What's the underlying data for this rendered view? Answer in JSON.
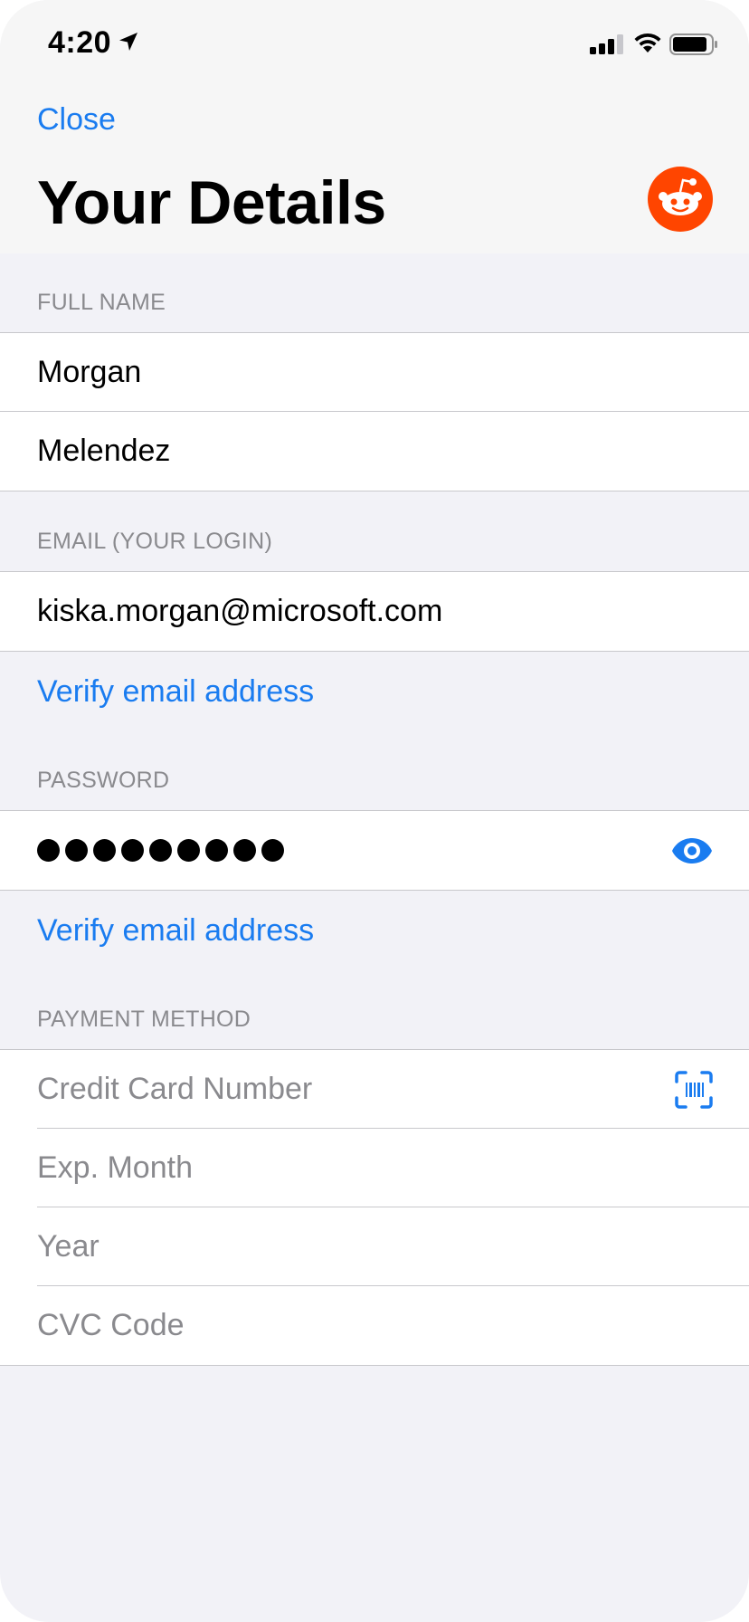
{
  "status_bar": {
    "time": "4:20",
    "icons": [
      "location-arrow-icon",
      "cellular-signal-icon",
      "wifi-icon",
      "battery-icon"
    ]
  },
  "nav": {
    "close_label": "Close",
    "title": "Your Details",
    "logo": "reddit-logo-icon"
  },
  "sections": {
    "full_name": {
      "header": "FULL NAME",
      "first_name": "Morgan",
      "last_name": "Melendez"
    },
    "email": {
      "header": "EMAIL (YOUR LOGIN)",
      "value": "kiska.morgan@microsoft.com",
      "verify_link": "Verify email address"
    },
    "password": {
      "header": "PASSWORD",
      "masked_length": 9,
      "reveal_icon": "eye-icon",
      "verify_link": "Verify email address"
    },
    "payment": {
      "header": "PAYMENT METHOD",
      "card_number_placeholder": "Credit Card Number",
      "scan_icon": "card-scan-icon",
      "exp_month_placeholder": "Exp. Month",
      "year_placeholder": "Year",
      "cvc_placeholder": "CVC Code"
    }
  },
  "colors": {
    "accent": "#1a7cf0",
    "reddit_orange": "#ff4500",
    "background": "#f2f2f7",
    "secondary_text": "#8a8a8e"
  }
}
